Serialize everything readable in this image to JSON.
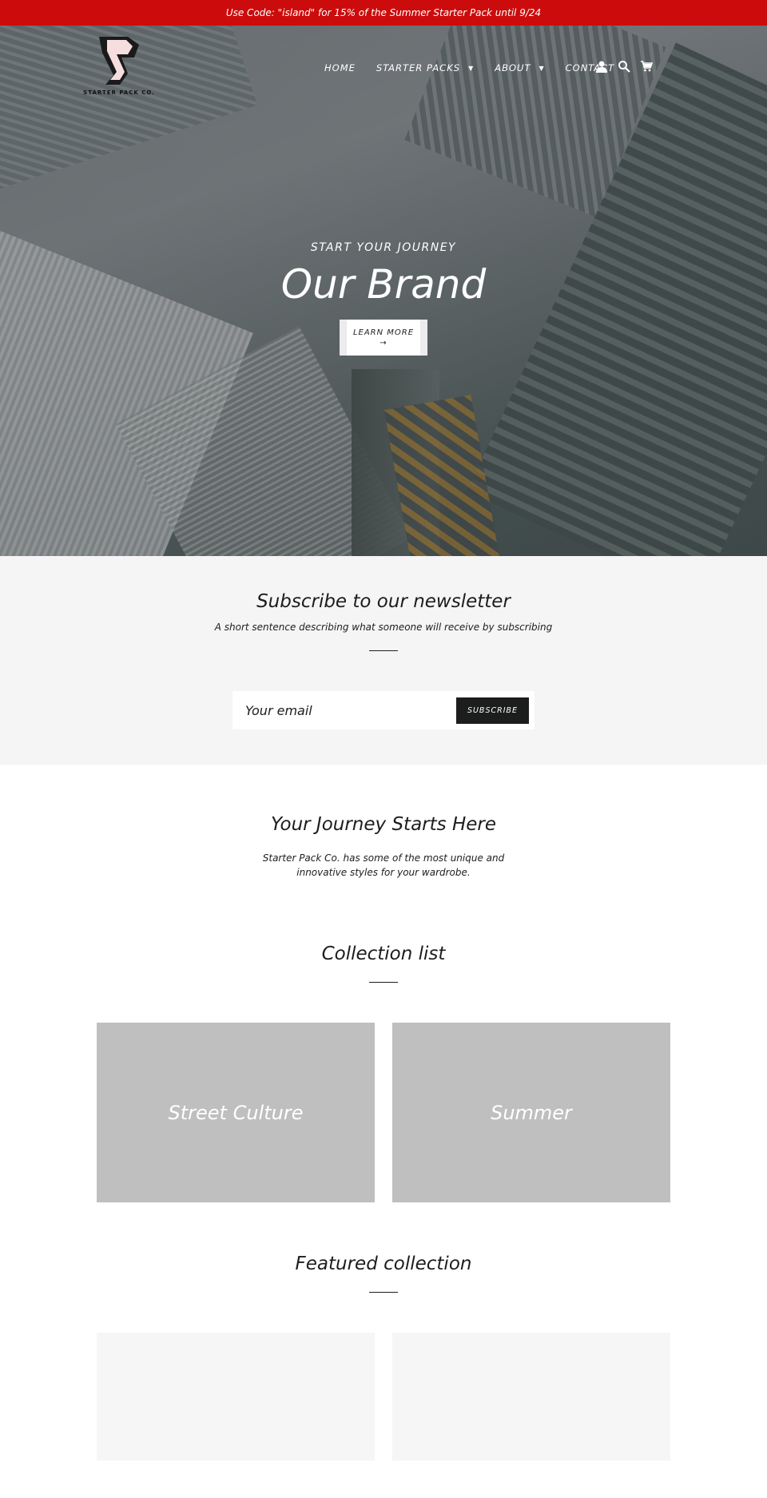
{
  "announcement": "Use Code: \"island\" for 15% of the Summer Starter Pack until 9/24",
  "brand": {
    "name": "STARTER PACK CO.",
    "accent": "#cc0c0c"
  },
  "nav": {
    "items": [
      {
        "label": "HOME",
        "dropdown": false
      },
      {
        "label": "STARTER PACKS",
        "dropdown": true
      },
      {
        "label": "ABOUT",
        "dropdown": true
      },
      {
        "label": "CONTACT",
        "dropdown": false
      }
    ],
    "icons": [
      "account-icon",
      "search-icon",
      "cart-icon"
    ]
  },
  "hero": {
    "subtitle": "START YOUR JOURNEY",
    "title": "Our Brand",
    "button_label": "LEARN MORE",
    "button_arrow": "→",
    "slides": 3,
    "active_slide": 3
  },
  "newsletter": {
    "title": "Subscribe to our newsletter",
    "subtitle": "A short sentence describing what someone will receive by subscribing",
    "email_placeholder": "Your email",
    "button_label": "SUBSCRIBE"
  },
  "journey": {
    "title": "Your Journey Starts Here",
    "text": "Starter Pack Co. has some of the most unique and innovative styles for your wardrobe."
  },
  "collection_list": {
    "title": "Collection list",
    "items": [
      {
        "label": "Street Culture"
      },
      {
        "label": "Summer"
      }
    ]
  },
  "featured": {
    "title": "Featured collection"
  }
}
